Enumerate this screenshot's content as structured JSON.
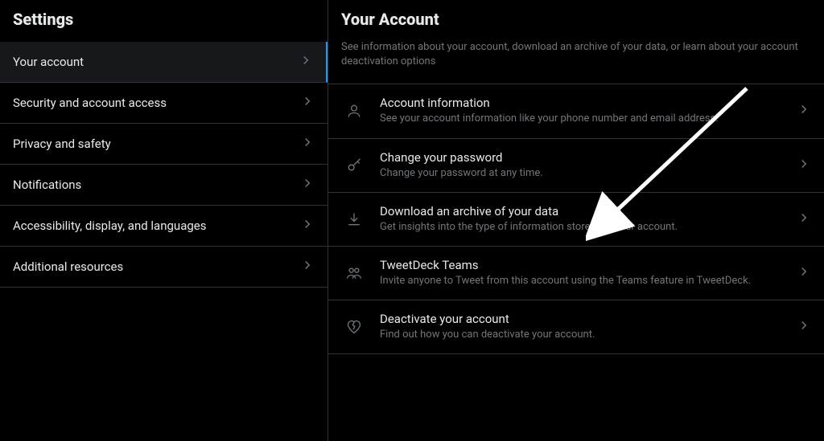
{
  "sidebar": {
    "title": "Settings",
    "items": [
      {
        "label": "Your account",
        "active": true
      },
      {
        "label": "Security and account access",
        "active": false
      },
      {
        "label": "Privacy and safety",
        "active": false
      },
      {
        "label": "Notifications",
        "active": false
      },
      {
        "label": "Accessibility, display, and languages",
        "active": false
      },
      {
        "label": "Additional resources",
        "active": false
      }
    ]
  },
  "main": {
    "title": "Your Account",
    "description": "See information about your account, download an archive of your data, or learn about your account deactivation options",
    "options": [
      {
        "icon": "user-icon",
        "title": "Account information",
        "sub": "See your account information like your phone number and email address."
      },
      {
        "icon": "key-icon",
        "title": "Change your password",
        "sub": "Change your password at any time."
      },
      {
        "icon": "download-icon",
        "title": "Download an archive of your data",
        "sub": "Get insights into the type of information stored for your account."
      },
      {
        "icon": "teams-icon",
        "title": "TweetDeck Teams",
        "sub": "Invite anyone to Tweet from this account using the Teams feature in TweetDeck."
      },
      {
        "icon": "heartbreak-icon",
        "title": "Deactivate your account",
        "sub": "Find out how you can deactivate your account."
      }
    ]
  }
}
